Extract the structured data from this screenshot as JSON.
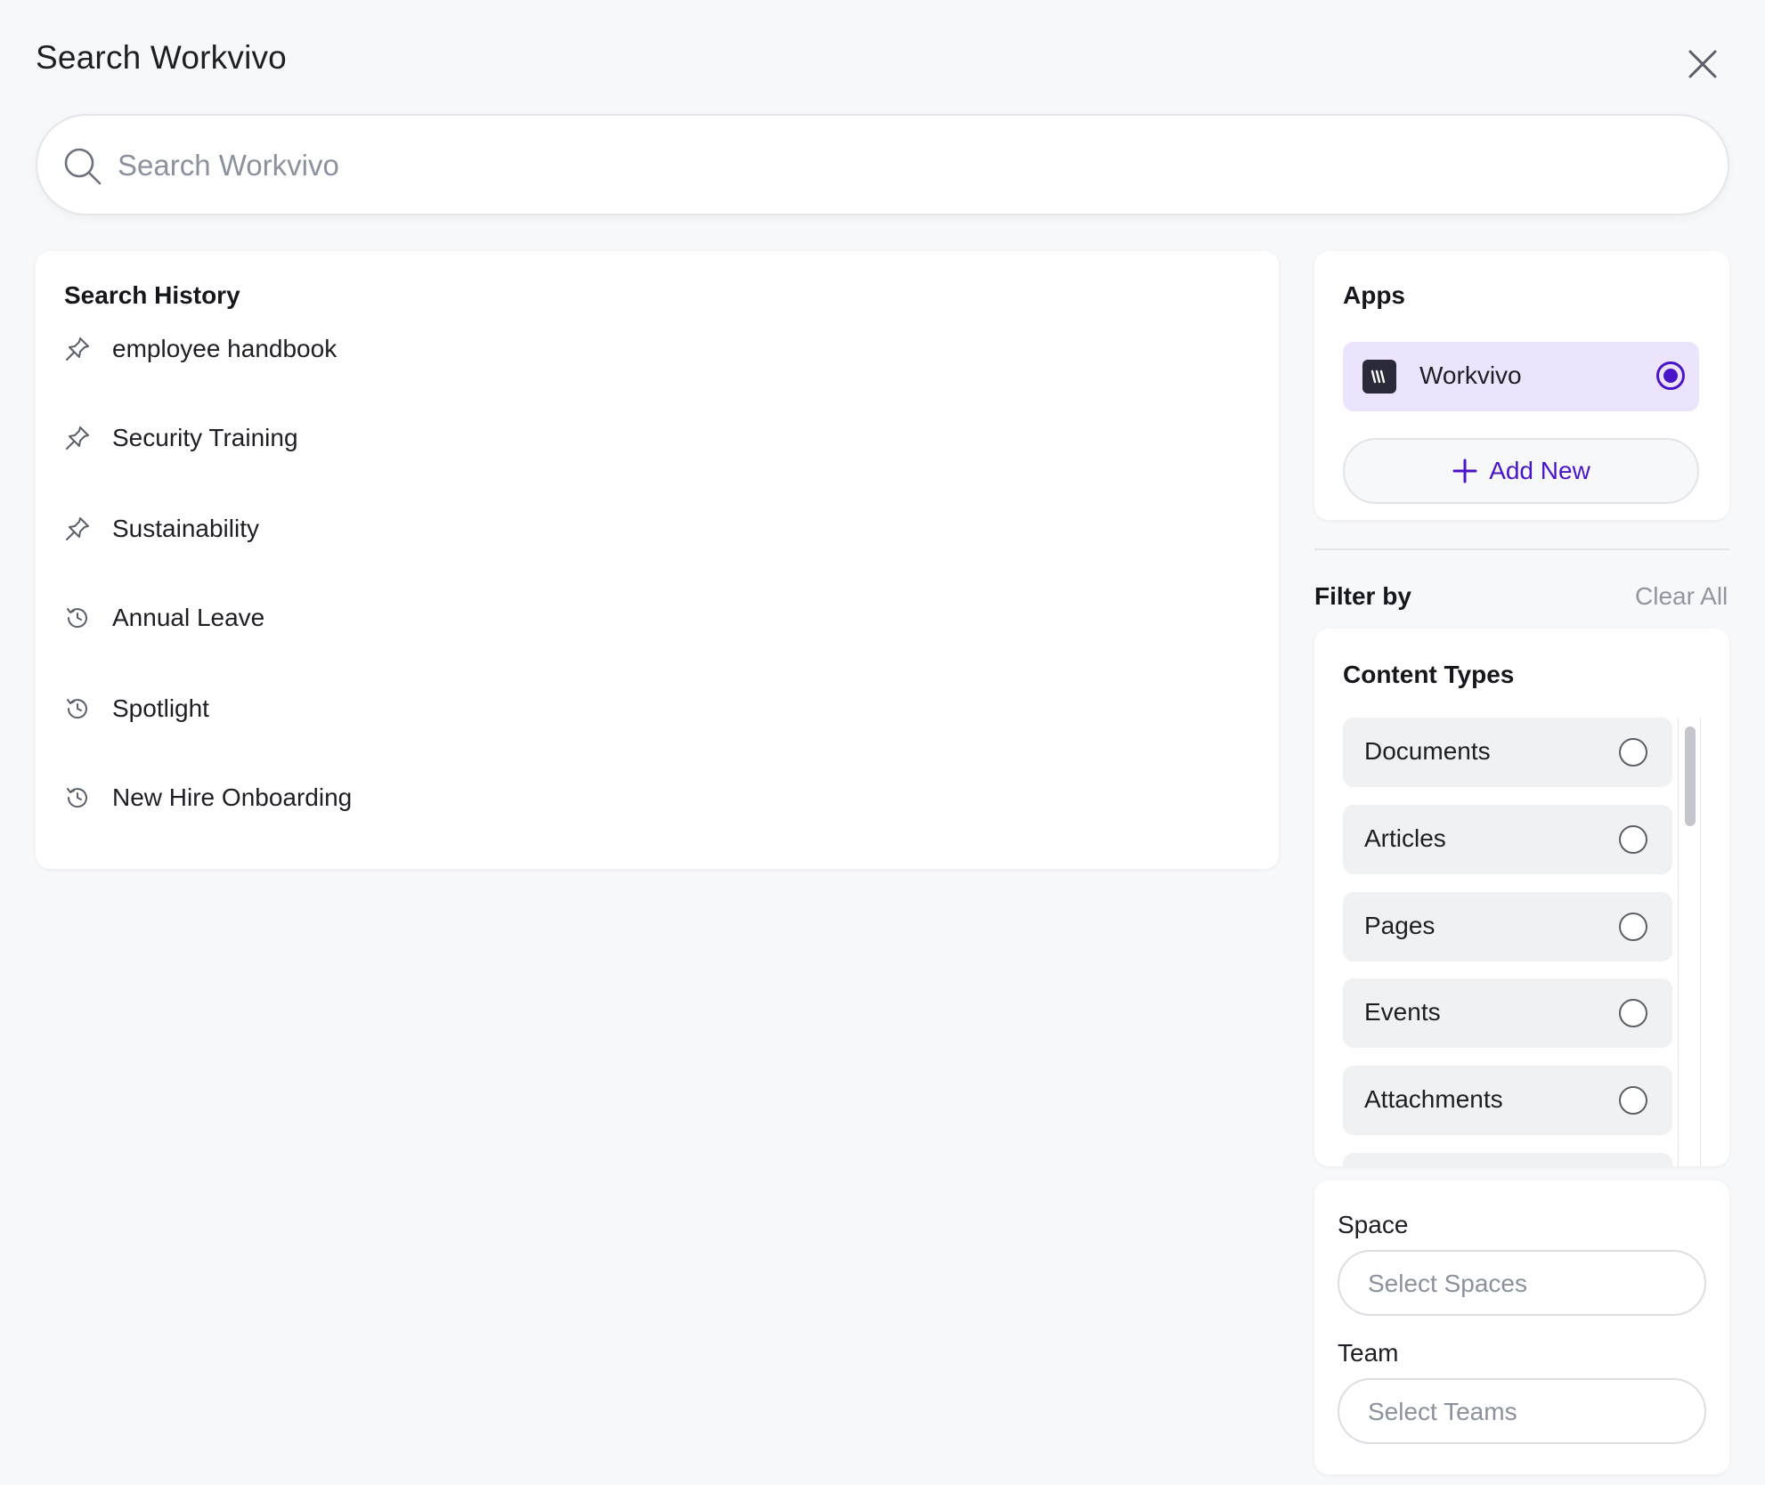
{
  "header": {
    "title": "Search Workvivo",
    "close_icon": "close-icon"
  },
  "search": {
    "placeholder": "Search Workvivo",
    "value": "",
    "icon": "search-icon"
  },
  "history": {
    "heading": "Search History",
    "items": [
      {
        "label": "employee handbook",
        "icon": "pin-icon"
      },
      {
        "label": "Security Training",
        "icon": "pin-icon"
      },
      {
        "label": "Sustainability",
        "icon": "pin-icon"
      },
      {
        "label": "Annual Leave",
        "icon": "history-icon"
      },
      {
        "label": "Spotlight",
        "icon": "history-icon"
      },
      {
        "label": "New Hire Onboarding",
        "icon": "history-icon"
      }
    ]
  },
  "apps": {
    "heading": "Apps",
    "items": [
      {
        "name": "Workvivo",
        "icon": "workvivo-logo-icon",
        "selected": true
      }
    ],
    "add_new_label": "Add New"
  },
  "filters": {
    "heading": "Filter by",
    "clear_all": "Clear All",
    "content_types": {
      "heading": "Content Types",
      "items": [
        {
          "label": "Documents",
          "selected": false
        },
        {
          "label": "Articles",
          "selected": false
        },
        {
          "label": "Pages",
          "selected": false
        },
        {
          "label": "Events",
          "selected": false
        },
        {
          "label": "Attachments",
          "selected": false
        }
      ]
    },
    "space": {
      "label": "Space",
      "placeholder": "Select Spaces"
    },
    "team": {
      "label": "Team",
      "placeholder": "Select Teams"
    }
  },
  "colors": {
    "accent": "#4a15c9",
    "selected_app_bg": "#ece4fd",
    "page_bg": "#f7f8fa"
  }
}
